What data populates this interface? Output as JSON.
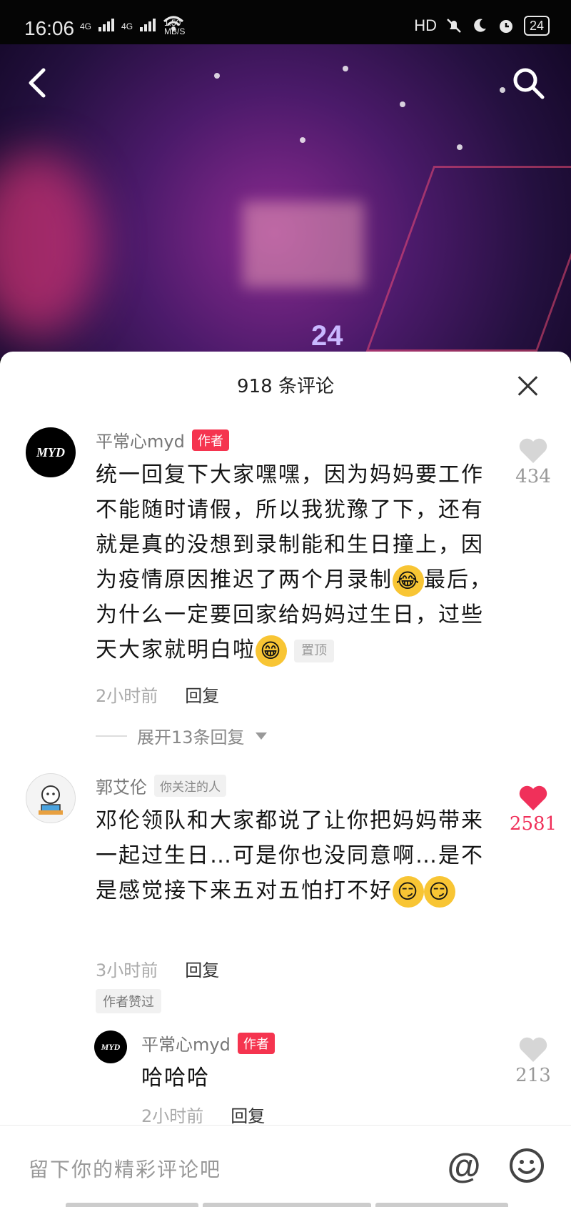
{
  "status_bar": {
    "time": "16:06",
    "network_1": "4G",
    "network_2": "4G",
    "speed_value": "1.50",
    "speed_unit": "MB/S",
    "hd_label": "HD",
    "battery": "24"
  },
  "colors": {
    "author_tag": "#f5344f",
    "liked": "#f0305a",
    "sheet_bg": "#ffffff"
  },
  "video": {
    "jersey_number": "24"
  },
  "sheet": {
    "title": "918 条评论"
  },
  "comments": [
    {
      "avatar_text": "MYD",
      "name": "平常心myd",
      "tag": "作者",
      "text": "统一回复下大家嘿嘿，因为妈妈要工作不能随时请假，所以我犹豫了下，还有就是真的没想到录制能和生日撞上，因为疫情原因推迟了两个月录制",
      "text_after_emoji": "最后，为什么一定要回家给妈妈过生日，过些天大家就明白啦",
      "pin_label": "置顶",
      "time": "2小时前",
      "reply": "回复",
      "likes": "434",
      "liked": false,
      "expand_label": "展开13条回复"
    },
    {
      "name": "郭艾伦",
      "tag": "你关注的人",
      "text": "邓伦领队和大家都说了让你把妈妈带来一起过生日…可是你也没同意啊…是不是感觉接下来五对五怕打不好",
      "time": "3小时前",
      "reply": "回复",
      "likes": "2581",
      "liked": true,
      "author_liked_label": "作者赞过"
    },
    {
      "avatar_text": "MYD",
      "name": "平常心myd",
      "tag": "作者",
      "text": "哈哈哈",
      "time": "2小时前",
      "reply": "回复",
      "likes": "213",
      "liked": false
    }
  ],
  "input": {
    "placeholder": "留下你的精彩评论吧",
    "at_symbol": "@"
  }
}
